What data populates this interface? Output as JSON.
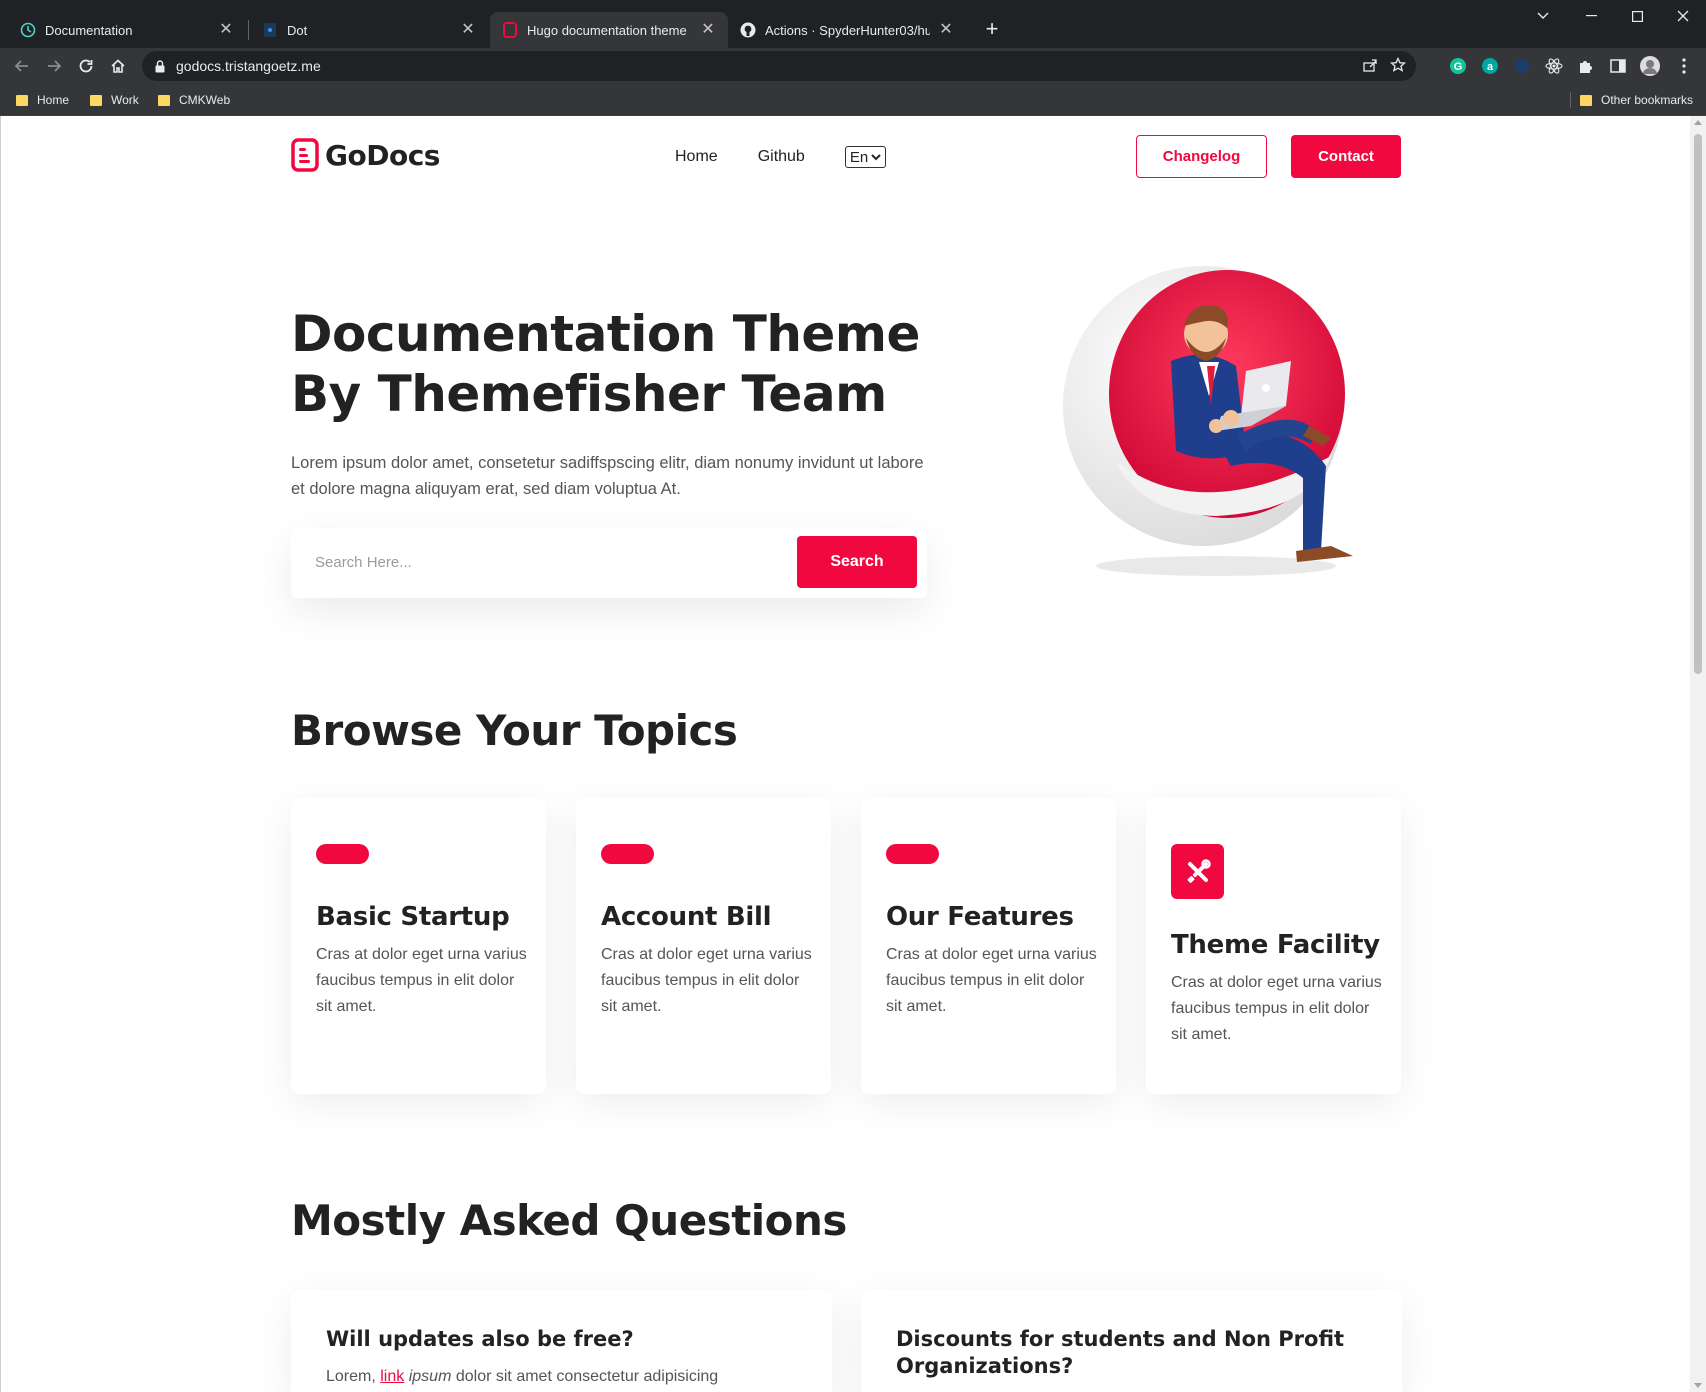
{
  "browser": {
    "tabs": [
      {
        "title": "Documentation",
        "icon": "teal-clock-icon"
      },
      {
        "title": "Dot",
        "icon": "dot-app-icon"
      },
      {
        "title": "Hugo documentation theme",
        "icon": "godocs-favicon-icon"
      },
      {
        "title": "Actions · SpyderHunter03/hugo-",
        "icon": "github-icon"
      }
    ],
    "active_tab_index": 2,
    "url": "godocs.tristangoetz.me",
    "bookmarks": [
      "Home",
      "Work",
      "CMKWeb"
    ],
    "other_bookmarks": "Other bookmarks"
  },
  "site": {
    "logo": "GoDocs",
    "nav": [
      "Home",
      "Github"
    ],
    "language": "En",
    "changelog_label": "Changelog",
    "contact_label": "Contact",
    "accent_color": "#f0083f"
  },
  "hero": {
    "title_line1": "Documentation Theme",
    "title_line2": "By Themefisher Team",
    "description": "Lorem ipsum dolor amet, consetetur sadiffspscing elitr, diam nonumy invidunt ut labore et dolore magna aliquyam erat, sed diam voluptua At.",
    "search_placeholder": "Search Here...",
    "search_button": "Search"
  },
  "topics": {
    "heading": "Browse Your Topics",
    "cards": [
      {
        "title": "Basic Startup",
        "text": "Cras at dolor eget urna varius faucibus tempus in elit dolor sit amet."
      },
      {
        "title": "Account Bill",
        "text": "Cras at dolor eget urna varius faucibus tempus in elit dolor sit amet."
      },
      {
        "title": "Our Features",
        "text": "Cras at dolor eget urna varius faucibus tempus in elit dolor sit amet."
      },
      {
        "title": "Theme Facility",
        "text": "Cras at dolor eget urna varius faucibus tempus in elit dolor sit amet.",
        "icon": "tools-icon"
      }
    ]
  },
  "faq": {
    "heading": "Mostly Asked Questions",
    "items": [
      {
        "question": "Will updates also be free?",
        "answer_prefix": "Lorem, ",
        "answer_link": "link",
        "answer_em": "ipsum",
        "answer_rest": " dolor sit amet consectetur adipisicing"
      },
      {
        "question": "Discounts for students and Non Profit Organizations?"
      }
    ]
  }
}
